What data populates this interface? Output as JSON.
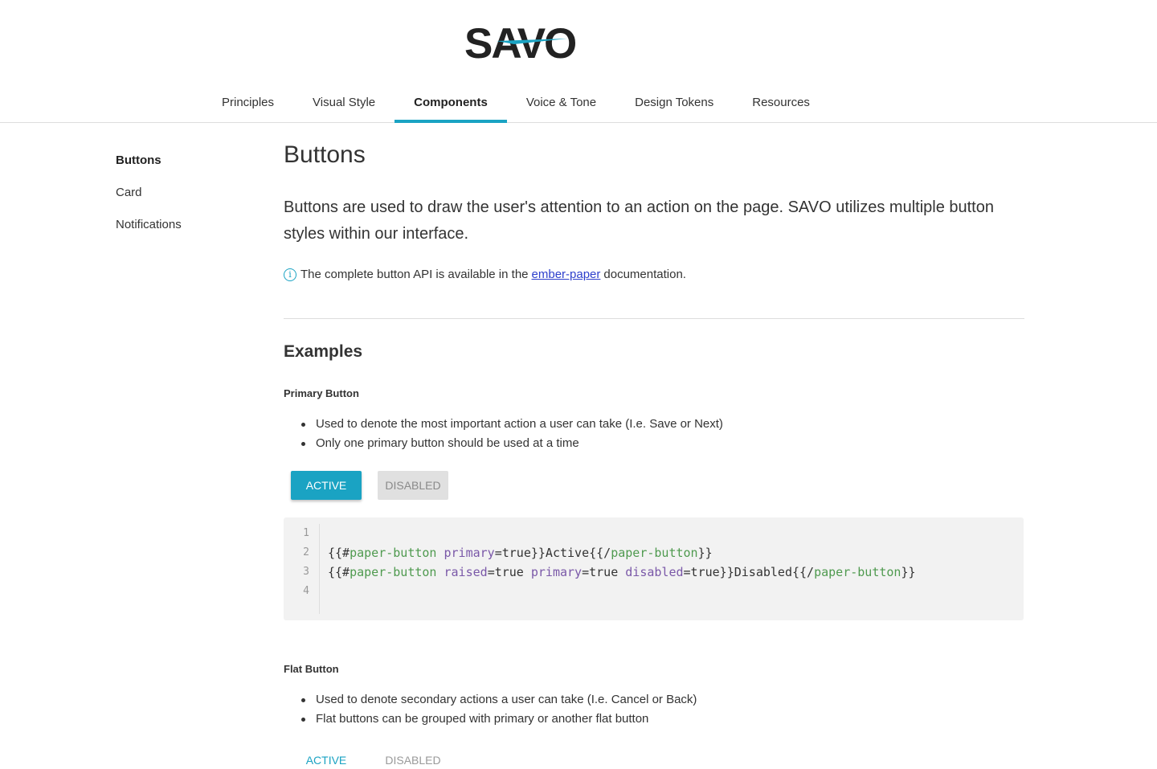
{
  "brand": {
    "logo_text": "SAVO",
    "accent": "#1aa3c3"
  },
  "nav": {
    "tabs": [
      {
        "label": "Principles"
      },
      {
        "label": "Visual Style"
      },
      {
        "label": "Components",
        "active": true
      },
      {
        "label": "Voice & Tone"
      },
      {
        "label": "Design Tokens"
      },
      {
        "label": "Resources"
      }
    ]
  },
  "sidebar": {
    "items": [
      {
        "label": "Buttons",
        "active": true
      },
      {
        "label": "Card"
      },
      {
        "label": "Notifications"
      }
    ]
  },
  "main": {
    "title": "Buttons",
    "intro": "Buttons are used to draw the user's attention to an action on the page. SAVO utilizes multiple button styles within our interface.",
    "info": {
      "icon": "info-circle-icon",
      "before": "The complete button API is available in the",
      "link": "ember-paper",
      "after": "documentation."
    },
    "examples_title": "Examples",
    "primary": {
      "title": "Primary Button",
      "bullets": [
        "Used to denote the most important action a user can take (I.e. Save or Next)",
        "Only one primary button should be used at a time"
      ],
      "active_label": "ACTIVE",
      "disabled_label": "DISABLED",
      "code": {
        "line_numbers": [
          "1",
          "2",
          "3",
          "4"
        ],
        "line2": {
          "open": "{{#",
          "comp": "paper-button",
          "attr1": "primary",
          "rest1": "=true}}Active{{/",
          "comp_close": "paper-button",
          "end": "}}"
        },
        "line3": {
          "open": "{{#",
          "comp": "paper-button",
          "attr1": "raised",
          "rest1": "=true ",
          "attr2": "primary",
          "rest2": "=true ",
          "attr3": "disabled",
          "rest3": "=true}}Disabled{{/",
          "comp_close": "paper-button",
          "end": "}}"
        }
      }
    },
    "flat": {
      "title": "Flat Button",
      "bullets": [
        "Used to denote secondary actions a user can take (I.e. Cancel or Back)",
        "Flat buttons can be grouped with primary or another flat button"
      ],
      "active_label": "ACTIVE",
      "disabled_label": "DISABLED"
    }
  }
}
